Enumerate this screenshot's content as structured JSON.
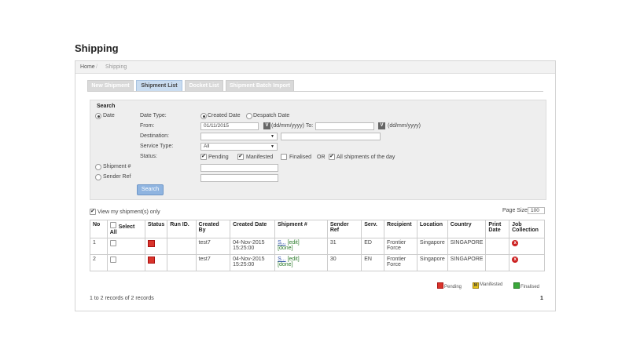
{
  "page": {
    "title": "Shipping"
  },
  "breadcrumb": {
    "home": "Home",
    "sep": "/",
    "current": "Shipping"
  },
  "tabs": [
    {
      "label": "New Shipment",
      "active": false
    },
    {
      "label": "Shipment List",
      "active": true
    },
    {
      "label": "Docket List",
      "active": false
    },
    {
      "label": "Shipment Batch Import",
      "active": false
    }
  ],
  "search": {
    "heading": "Search",
    "date_radio": "Date",
    "date_type_label": "Date Type:",
    "created_date": "Created Date",
    "despatch_date": "Despatch Date",
    "from_label": "From:",
    "from_value": "01/11/2015",
    "from_format": "(dd/mm/yyyy) To:",
    "to_format": "(dd/mm/yyyy)",
    "cal_glyph": "V",
    "destination_label": "Destination:",
    "service_type_label": "Service Type:",
    "service_type_value": "All",
    "status_label": "Status:",
    "pending": "Pending",
    "manifested": "Manifested",
    "finalised": "Finalised",
    "or": "OR",
    "all_of_day": "All shipments of the day",
    "shipment_no": "Shipment #",
    "sender_ref": "Sender Ref",
    "search_button": "Search"
  },
  "list": {
    "view_my": "View my shipment(s) only",
    "page_size_label": "Page Size :",
    "page_size_value": "100",
    "headers": {
      "no": "No",
      "select_all": "Select All",
      "status": "Status",
      "run_id": "Run ID.",
      "created_by": "Created By",
      "created_date": "Created Date",
      "shipment": "Shipment #",
      "sender_ref": "Sender Ref",
      "serv": "Serv.",
      "recipient": "Recipient",
      "location": "Location",
      "country": "Country",
      "print_date": "Print Date",
      "job_collection": "Job Collection"
    },
    "rows": [
      {
        "no": "1",
        "created_by": "test7",
        "created_date": "04-Nov-2015 15:25:00",
        "shipment": "S...",
        "edit": "[edit]",
        "done": "[done]",
        "sender_ref": "31",
        "serv": "ED",
        "recipient": "Frontier Force",
        "location": "Singapore",
        "country": "SINGAPORE",
        "print_date": ""
      },
      {
        "no": "2",
        "created_by": "test7",
        "created_date": "04-Nov-2015 15:25:00",
        "shipment": "S...",
        "edit": "[edit]",
        "done": "[done]",
        "sender_ref": "30",
        "serv": "EN",
        "recipient": "Frontier Force",
        "location": "Singapore",
        "country": "SINGAPORE",
        "print_date": ""
      }
    ],
    "flag_glyph_manifested": "M",
    "x_glyph": "x",
    "legend": {
      "pending": "Pending",
      "manifested": "Manifested",
      "finalised": "Finalised"
    },
    "records_text": "1 to 2 records of 2 records",
    "page_number": "1"
  },
  "colors": {
    "status_pending": "#d9342b",
    "status_manifested": "#e8c31a",
    "status_finalised": "#3aa83a",
    "active_tab": "#c9dcf0",
    "search_button": "#8fb4e0"
  }
}
